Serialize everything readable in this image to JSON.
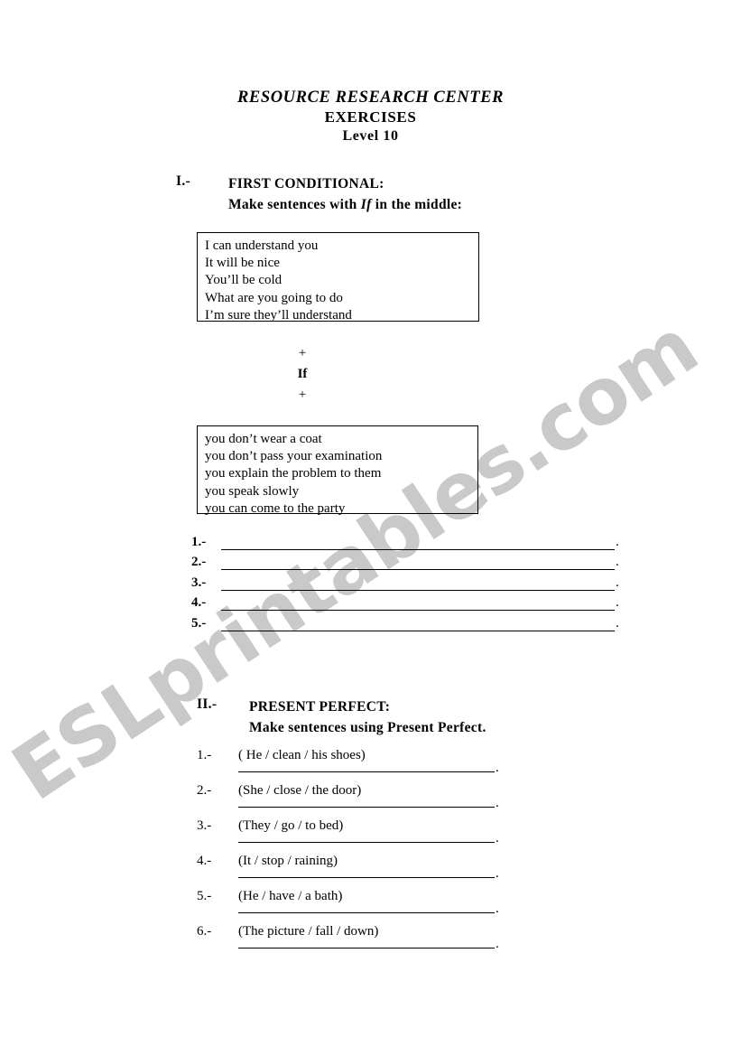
{
  "document": {
    "title_line1": "RESOURCE RESEARCH CENTER",
    "title_line2": "EXERCISES",
    "title_line3": "Level 10",
    "watermark": "ESLprintables.com",
    "watermark_color": "#c9c9c9",
    "background_color": "#ffffff",
    "text_color": "#000000"
  },
  "section_1": {
    "number": "I.-",
    "heading": "FIRST CONDITIONAL:",
    "instruction_before": "Make sentences with",
    "instruction_keyword": "If",
    "instruction_after": "in the middle:",
    "box_top": [
      "I can understand you",
      "It will be nice",
      "You’ll be cold",
      "What are you going to do",
      "I’m sure they’ll understand"
    ],
    "connector": {
      "plus_top": "+",
      "keyword": "If",
      "plus_bottom": "+"
    },
    "box_bottom": [
      "you don’t wear a coat",
      "you don’t pass your examination",
      "you explain the problem to them",
      "you speak slowly",
      "you can come to the party"
    ],
    "answer_lines": [
      {
        "number": "1.-",
        "value": "",
        "end_punct": "."
      },
      {
        "number": "2.-",
        "value": "",
        "end_punct": "."
      },
      {
        "number": "3.-",
        "value": "",
        "end_punct": "."
      },
      {
        "number": "4.-",
        "value": "",
        "end_punct": "."
      },
      {
        "number": "5.-",
        "value": "",
        "end_punct": "."
      }
    ]
  },
  "section_2": {
    "number": "II.-",
    "heading": "PRESENT PERFECT:",
    "instruction": "Make sentences using Present Perfect.",
    "items": [
      {
        "number": "1.-",
        "prompt": "( He / clean / his shoes)",
        "answer": "",
        "end_punct": "."
      },
      {
        "number": "2.-",
        "prompt": "(She / close / the door)",
        "answer": "",
        "end_punct": "."
      },
      {
        "number": "3.-",
        "prompt": "(They / go / to bed)",
        "answer": "",
        "end_punct": "."
      },
      {
        "number": "4.-",
        "prompt": "(It / stop / raining)",
        "answer": "",
        "end_punct": "."
      },
      {
        "number": "5.-",
        "prompt": "(He / have / a bath)",
        "answer": "",
        "end_punct": "."
      },
      {
        "number": "6.-",
        "prompt": "(The picture / fall / down)",
        "answer": "",
        "end_punct": "."
      }
    ]
  }
}
